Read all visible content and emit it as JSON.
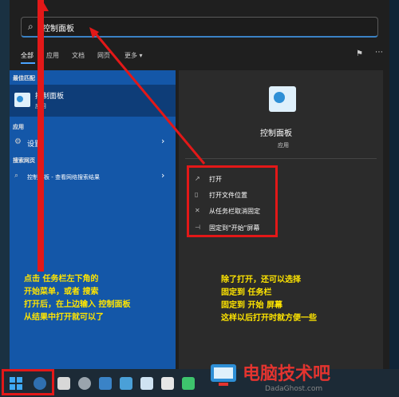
{
  "search": {
    "query": "控制面板"
  },
  "tabs": [
    "全部",
    "应用",
    "文档",
    "网页",
    "更多 ▾"
  ],
  "left": {
    "best_match_heading": "最佳匹配",
    "best_match_title": "控制面板",
    "best_match_sub": "应用",
    "apps_heading": "应用",
    "apps_item": "设置",
    "web_heading": "搜索网页",
    "web_item": "控制面板 - 查看网络搜索结果"
  },
  "right": {
    "title": "控制面板",
    "sub": "应用",
    "actions": [
      "打开",
      "打开文件位置",
      "从任务栏取消固定",
      "固定到\"开始\"屏幕"
    ]
  },
  "notes": {
    "left": [
      "点击 任务栏左下角的",
      "开始菜单，或者 搜索",
      "打开后，在上边输入 控制面板",
      "从结果中打开就可以了"
    ],
    "right": [
      "除了打开，还可以选择",
      "固定到 任务栏",
      "固定到 开始 屏幕",
      "这样以后打开时就方便一些"
    ]
  },
  "watermark": {
    "main": "电脑技术吧",
    "sub": "DadaGhost.com"
  },
  "colors": {
    "accent": "#1457a8",
    "annotation": "#e31818",
    "note": "#ffe500"
  },
  "icons": [
    "search-icon",
    "control-panel-icon",
    "settings-icon",
    "chevron-right-icon",
    "windows-start-icon",
    "pin-icon"
  ]
}
